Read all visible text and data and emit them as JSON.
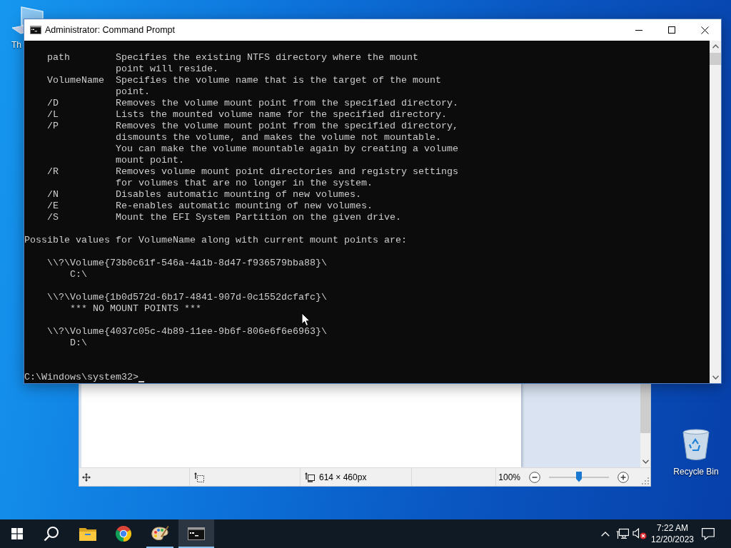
{
  "desktop_icons": [
    {
      "kind": "this-pc",
      "label": "Th"
    },
    {
      "kind": "recycle-bin",
      "label": "Recycle Bin"
    }
  ],
  "paint_window": {
    "status_bar": {
      "image_size": "614 × 460px",
      "zoom": "100%",
      "zoom_slider": {
        "level": 0.5
      }
    }
  },
  "cmd_window": {
    "title": "Administrator: Command Prompt",
    "options": [
      {
        "flag": "path",
        "description": [
          "Specifies the existing NTFS directory where the mount",
          "point will reside."
        ]
      },
      {
        "flag": "VolumeName",
        "description": [
          "Specifies the volume name that is the target of the mount",
          "point."
        ]
      },
      {
        "flag": "/D",
        "description": [
          "Removes the volume mount point from the specified directory."
        ]
      },
      {
        "flag": "/L",
        "description": [
          "Lists the mounted volume name for the specified directory."
        ]
      },
      {
        "flag": "/P",
        "description": [
          "Removes the volume mount point from the specified directory,",
          "dismounts the volume, and makes the volume not mountable.",
          "You can make the volume mountable again by creating a volume",
          "mount point."
        ]
      },
      {
        "flag": "/R",
        "description": [
          "Removes volume mount point directories and registry settings",
          "for volumes that are no longer in the system."
        ]
      },
      {
        "flag": "/N",
        "description": [
          "Disables automatic mounting of new volumes."
        ]
      },
      {
        "flag": "/E",
        "description": [
          "Re-enables automatic mounting of new volumes."
        ]
      },
      {
        "flag": "/S",
        "description": [
          "Mount the EFI System Partition on the given drive."
        ]
      }
    ],
    "volumes_heading": "Possible values for VolumeName along with current mount points are:",
    "volumes": [
      {
        "name": "\\\\?\\Volume{73b0c61f-546a-4a1b-8d47-f936579bba88}\\",
        "mount": "C:\\"
      },
      {
        "name": "\\\\?\\Volume{1b0d572d-6b17-4841-907d-0c1552dcfafc}\\",
        "mount": "*** NO MOUNT POINTS ***"
      },
      {
        "name": "\\\\?\\Volume{4037c05c-4b89-11ee-9b6f-806e6f6e6963}\\",
        "mount": "D:\\"
      }
    ],
    "prompt": "C:\\Windows\\system32>"
  },
  "taskbar": {
    "buttons": [
      {
        "kind": "start",
        "running": false,
        "selected": false
      },
      {
        "kind": "search",
        "running": false,
        "selected": false
      },
      {
        "kind": "explorer",
        "running": false,
        "selected": false
      },
      {
        "kind": "chrome",
        "running": false,
        "selected": false
      },
      {
        "kind": "paint",
        "running": true,
        "selected": false
      },
      {
        "kind": "cmd",
        "running": true,
        "selected": true
      }
    ],
    "tray": {
      "time": "7:22 AM",
      "date": "12/20/2023"
    }
  }
}
